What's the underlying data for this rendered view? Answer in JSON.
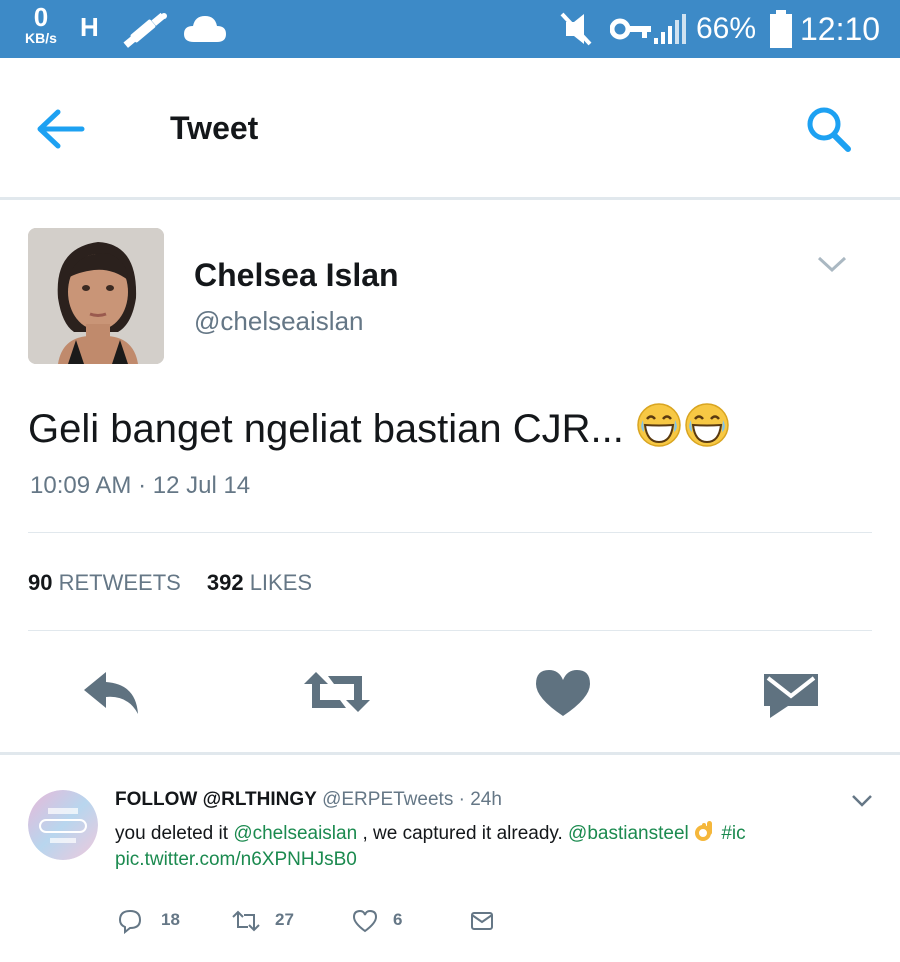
{
  "status_bar": {
    "net_speed": "0",
    "net_unit": "KB/s",
    "network_type": "H",
    "battery": "66%",
    "time": "12:10",
    "icons": [
      "h-network-icon",
      "satellite-icon",
      "cloud-icon",
      "mute-icon",
      "vpn-key-icon",
      "signal-icon",
      "battery-icon"
    ]
  },
  "app_bar": {
    "title": "Tweet",
    "back_icon": "back-arrow-icon",
    "search_icon": "search-icon"
  },
  "tweet": {
    "author_name": "Chelsea Islan",
    "author_handle": "@chelseaislan",
    "text": "Geli banget ngeliat bastian CJR...",
    "emojis": [
      "laughing-face-emoji",
      "laughing-face-emoji"
    ],
    "timestamp": "10:09 AM · 12 Jul 14",
    "retweets_count": "90",
    "retweets_label": "RETWEETS",
    "likes_count": "392",
    "likes_label": "LIKES",
    "actions": [
      "reply-icon",
      "retweet-icon",
      "like-icon",
      "share-icon"
    ]
  },
  "reply": {
    "name": "FOLLOW @RLTHINGY",
    "handle": "@ERPETweets · 24h",
    "text_part1": "you deleted it",
    "mention1": "@chelseaislan",
    "text_part2": ", we captured it already.",
    "mention2": "@bastiansteel",
    "hashtag": "#ic",
    "pic_link": "pic.twitter.com/n6XPNHJsB0",
    "replies_count": "18",
    "retweets_count": "27",
    "likes_count": "6"
  },
  "colors": {
    "status_bar": "#3d8ac7",
    "accent_blue": "#1da1f2",
    "link_green": "#1b8a4f",
    "muted_gray": "#657786",
    "action_gray": "#657786"
  }
}
